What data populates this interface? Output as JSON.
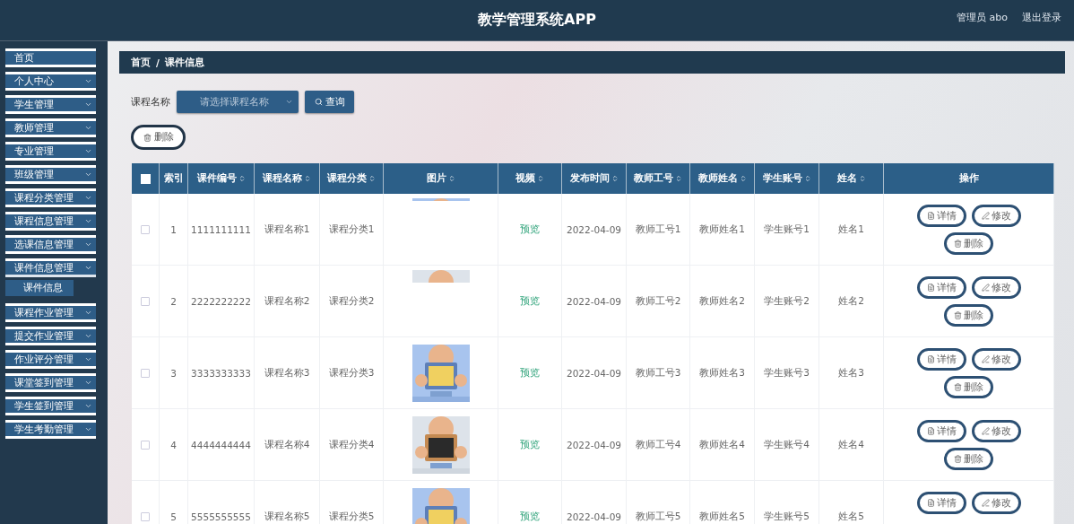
{
  "header": {
    "title": "教学管理系统APP",
    "user": "管理员 abo",
    "logout": "退出登录"
  },
  "sidebar": {
    "items": [
      {
        "label": "首页",
        "expandable": false,
        "expanded": false
      },
      {
        "label": "个人中心",
        "expandable": true,
        "expanded": false
      },
      {
        "label": "学生管理",
        "expandable": true,
        "expanded": false
      },
      {
        "label": "教师管理",
        "expandable": true,
        "expanded": false
      },
      {
        "label": "专业管理",
        "expandable": true,
        "expanded": false
      },
      {
        "label": "班级管理",
        "expandable": true,
        "expanded": false
      },
      {
        "label": "课程分类管理",
        "expandable": true,
        "expanded": false
      },
      {
        "label": "课程信息管理",
        "expandable": true,
        "expanded": false
      },
      {
        "label": "选课信息管理",
        "expandable": true,
        "expanded": false
      },
      {
        "label": "课件信息管理",
        "expandable": true,
        "expanded": true,
        "children": [
          {
            "label": "课件信息"
          }
        ]
      },
      {
        "label": "课程作业管理",
        "expandable": true,
        "expanded": false
      },
      {
        "label": "提交作业管理",
        "expandable": true,
        "expanded": false
      },
      {
        "label": "作业评分管理",
        "expandable": true,
        "expanded": false
      },
      {
        "label": "课堂签到管理",
        "expandable": true,
        "expanded": false
      },
      {
        "label": "学生签到管理",
        "expandable": true,
        "expanded": false
      },
      {
        "label": "学生考勤管理",
        "expandable": true,
        "expanded": false
      }
    ]
  },
  "breadcrumb": [
    "首页",
    "/",
    "课件信息"
  ],
  "filter": {
    "label": "课程名称",
    "placeholder": "请选择课程名称",
    "search_button": "查询"
  },
  "delete_button": "删除",
  "table": {
    "all_checked": false,
    "columns": [
      {
        "label": "索引",
        "sortable": false
      },
      {
        "label": "课件编号",
        "sortable": true
      },
      {
        "label": "课程名称",
        "sortable": true
      },
      {
        "label": "课程分类",
        "sortable": true
      },
      {
        "label": "图片",
        "sortable": true
      },
      {
        "label": "视频",
        "sortable": true
      },
      {
        "label": "发布时间",
        "sortable": true
      },
      {
        "label": "教师工号",
        "sortable": true
      },
      {
        "label": "教师姓名",
        "sortable": true
      },
      {
        "label": "学生账号",
        "sortable": true
      },
      {
        "label": "姓名",
        "sortable": true
      },
      {
        "label": "操作",
        "sortable": false
      }
    ],
    "rows": [
      {
        "checked": false,
        "index": "1",
        "code": "1111111111",
        "course": "课程名称1",
        "category": "课程分类1",
        "image": {
          "kind": "strip"
        },
        "video": "预览",
        "date": "2022-04-09",
        "teacher_id": "教师工号1",
        "teacher_name": "教师姓名1",
        "student": "学生账号1",
        "name": "姓名1",
        "actions": [
          "详情",
          "修改",
          "删除"
        ]
      },
      {
        "checked": false,
        "index": "2",
        "code": "2222222222",
        "course": "课程名称2",
        "category": "课程分类2",
        "image": {
          "kind": "band"
        },
        "video": "预览",
        "date": "2022-04-09",
        "teacher_id": "教师工号2",
        "teacher_name": "教师姓名2",
        "student": "学生账号2",
        "name": "姓名2",
        "actions": [
          "详情",
          "修改",
          "删除"
        ]
      },
      {
        "checked": false,
        "index": "3",
        "code": "3333333333",
        "course": "课程名称3",
        "category": "课程分类3",
        "image": {
          "kind": "picture"
        },
        "video": "预览",
        "date": "2022-04-09",
        "teacher_id": "教师工号3",
        "teacher_name": "教师姓名3",
        "student": "学生账号3",
        "name": "姓名3",
        "actions": [
          "详情",
          "修改",
          "删除"
        ]
      },
      {
        "checked": false,
        "index": "4",
        "code": "4444444444",
        "course": "课程名称4",
        "category": "课程分类4",
        "image": {
          "kind": "picture"
        },
        "video": "预览",
        "date": "2022-04-09",
        "teacher_id": "教师工号4",
        "teacher_name": "教师姓名4",
        "student": "学生账号4",
        "name": "姓名4",
        "actions": [
          "详情",
          "修改",
          "删除"
        ]
      },
      {
        "checked": false,
        "index": "5",
        "code": "5555555555",
        "course": "课程名称5",
        "category": "课程分类5",
        "image": {
          "kind": "picture"
        },
        "video": "预览",
        "date": "2022-04-09",
        "teacher_id": "教师工号5",
        "teacher_name": "教师姓名5",
        "student": "学生账号5",
        "name": "姓名5",
        "actions": [
          "详情",
          "修改"
        ]
      }
    ]
  }
}
